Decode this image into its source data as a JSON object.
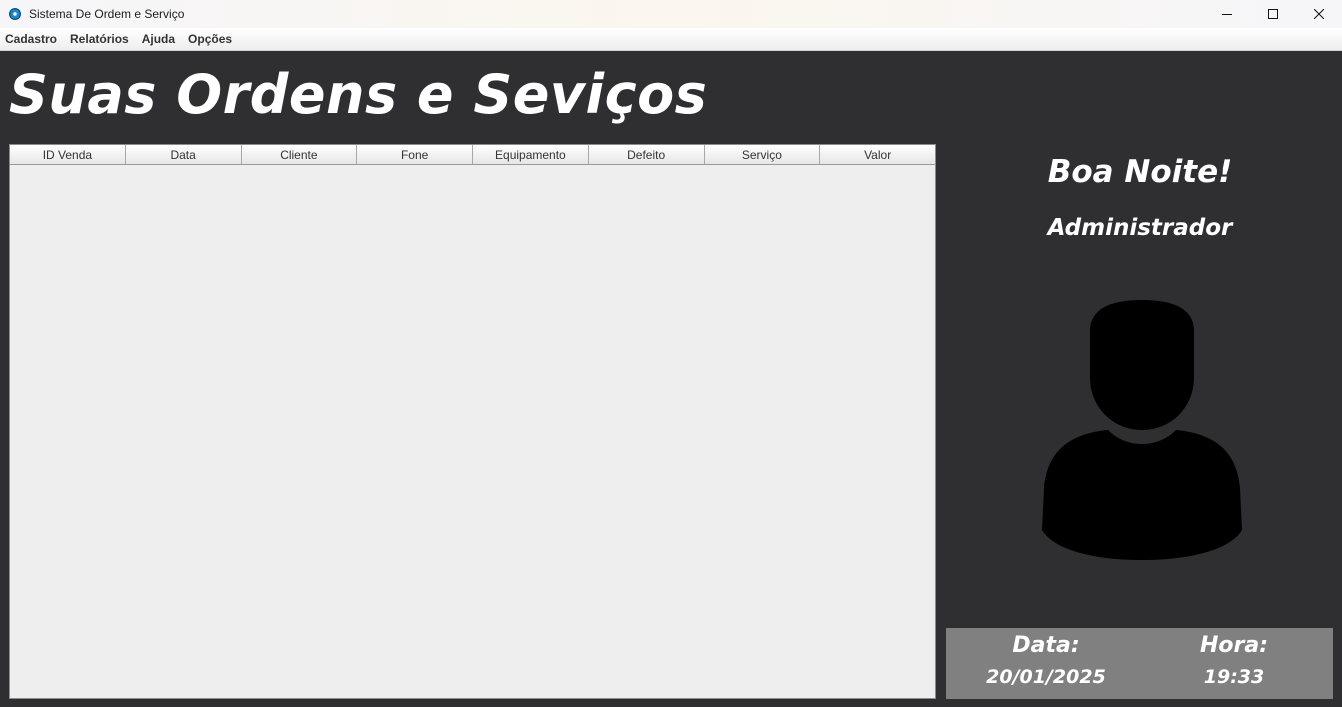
{
  "window": {
    "title": "Sistema De Ordem e Serviço",
    "icon": "app-icon"
  },
  "menu": [
    "Cadastro",
    "Relatórios",
    "Ajuda",
    "Opções"
  ],
  "heading": "Suas Ordens e Seviços",
  "table": {
    "columns": [
      "ID Venda",
      "Data",
      "Cliente",
      "Fone",
      "Equipamento",
      "Defeito",
      "Serviço",
      "Valor"
    ],
    "rows": []
  },
  "sidebar": {
    "greeting": "Boa Noite!",
    "user": "Administrador",
    "avatar_icon": "user-silhouette-icon",
    "date_label": "Data:",
    "date_value": "20/01/2025",
    "time_label": "Hora:",
    "time_value": "19:33"
  },
  "colors": {
    "background": "#2f2f31",
    "table_background": "#eeeeee",
    "datetime_panel": "#808080",
    "text": "#ffffff"
  }
}
